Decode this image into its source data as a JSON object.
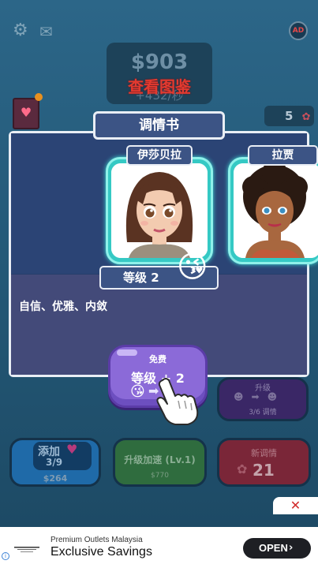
{
  "game": {
    "money": "$903",
    "money_rate": "+432/秒",
    "view_album": "查看图鉴",
    "kiss_count": "5",
    "ad_badge": "AD",
    "icons": [
      "gear-icon",
      "mail-icon",
      "ad-icon",
      "book-icon",
      "heart-icon"
    ]
  },
  "panel": {
    "title": "调情书",
    "characters": [
      {
        "name": "伊莎贝拉"
      },
      {
        "name": "拉贾"
      }
    ],
    "level_label": "等级 2",
    "traits": "自信、优雅、内敛",
    "free_button": {
      "label": "免费",
      "action": "等级 + 2"
    }
  },
  "actions": {
    "add": {
      "label": "添加",
      "progress": "3/9",
      "cost": "$264"
    },
    "speed": {
      "label": "升级加速 (Lv.1)",
      "cost": "$770"
    },
    "flirt": {
      "label": "新调情",
      "count": "21"
    },
    "upgrade": {
      "label": "升级",
      "progress": "3/6 调情"
    }
  },
  "close_symbol": "✕",
  "ad": {
    "subtitle": "Premium Outlets Malaysia",
    "headline": "Exclusive Savings",
    "cta": "OPEN"
  },
  "colors": {
    "background": "#1e4a67",
    "panel": "#2b4475",
    "accent_cyan": "#35c9c4",
    "button_purple": "#8b6ad8",
    "alert_red": "#e23a30"
  }
}
